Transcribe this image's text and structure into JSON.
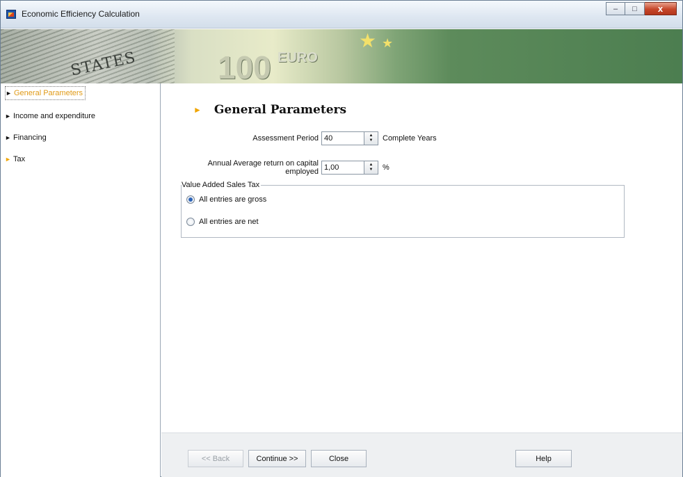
{
  "window": {
    "title": "Economic Efficiency Calculation",
    "controls": {
      "minimize": "–",
      "maximize": "□",
      "close": "x"
    }
  },
  "banner": {
    "dollar_text": "STATES",
    "euro_amount": "100",
    "euro_word": "EURO"
  },
  "sidebar": {
    "items": [
      {
        "label": "General Parameters",
        "active": true
      },
      {
        "label": "Income and expenditure",
        "active": false
      },
      {
        "label": "Financing",
        "active": false
      },
      {
        "label": "Tax",
        "active": false
      }
    ],
    "arrow_glyph": "►"
  },
  "main": {
    "heading": "General Parameters",
    "heading_marker": "►",
    "assessment": {
      "label": "Assessment Period",
      "value": "40",
      "unit": "Complete Years"
    },
    "return": {
      "label_line1": "Annual Average return on capital",
      "label_line2": "employed",
      "value": "1,00",
      "unit": "%"
    },
    "vat": {
      "legend": "Value Added Sales Tax",
      "options": [
        {
          "label": "All entries are gross",
          "checked": true
        },
        {
          "label": "All entries are net",
          "checked": false
        }
      ]
    },
    "spinner_up": "▲",
    "spinner_down": "▼"
  },
  "footer": {
    "back": "<< Back",
    "continue": "Continue >>",
    "close": "Close",
    "help": "Help"
  },
  "colors": {
    "accent_orange": "#f0a500",
    "active_text": "#e09a16",
    "radio_fill": "#2c64b8"
  }
}
